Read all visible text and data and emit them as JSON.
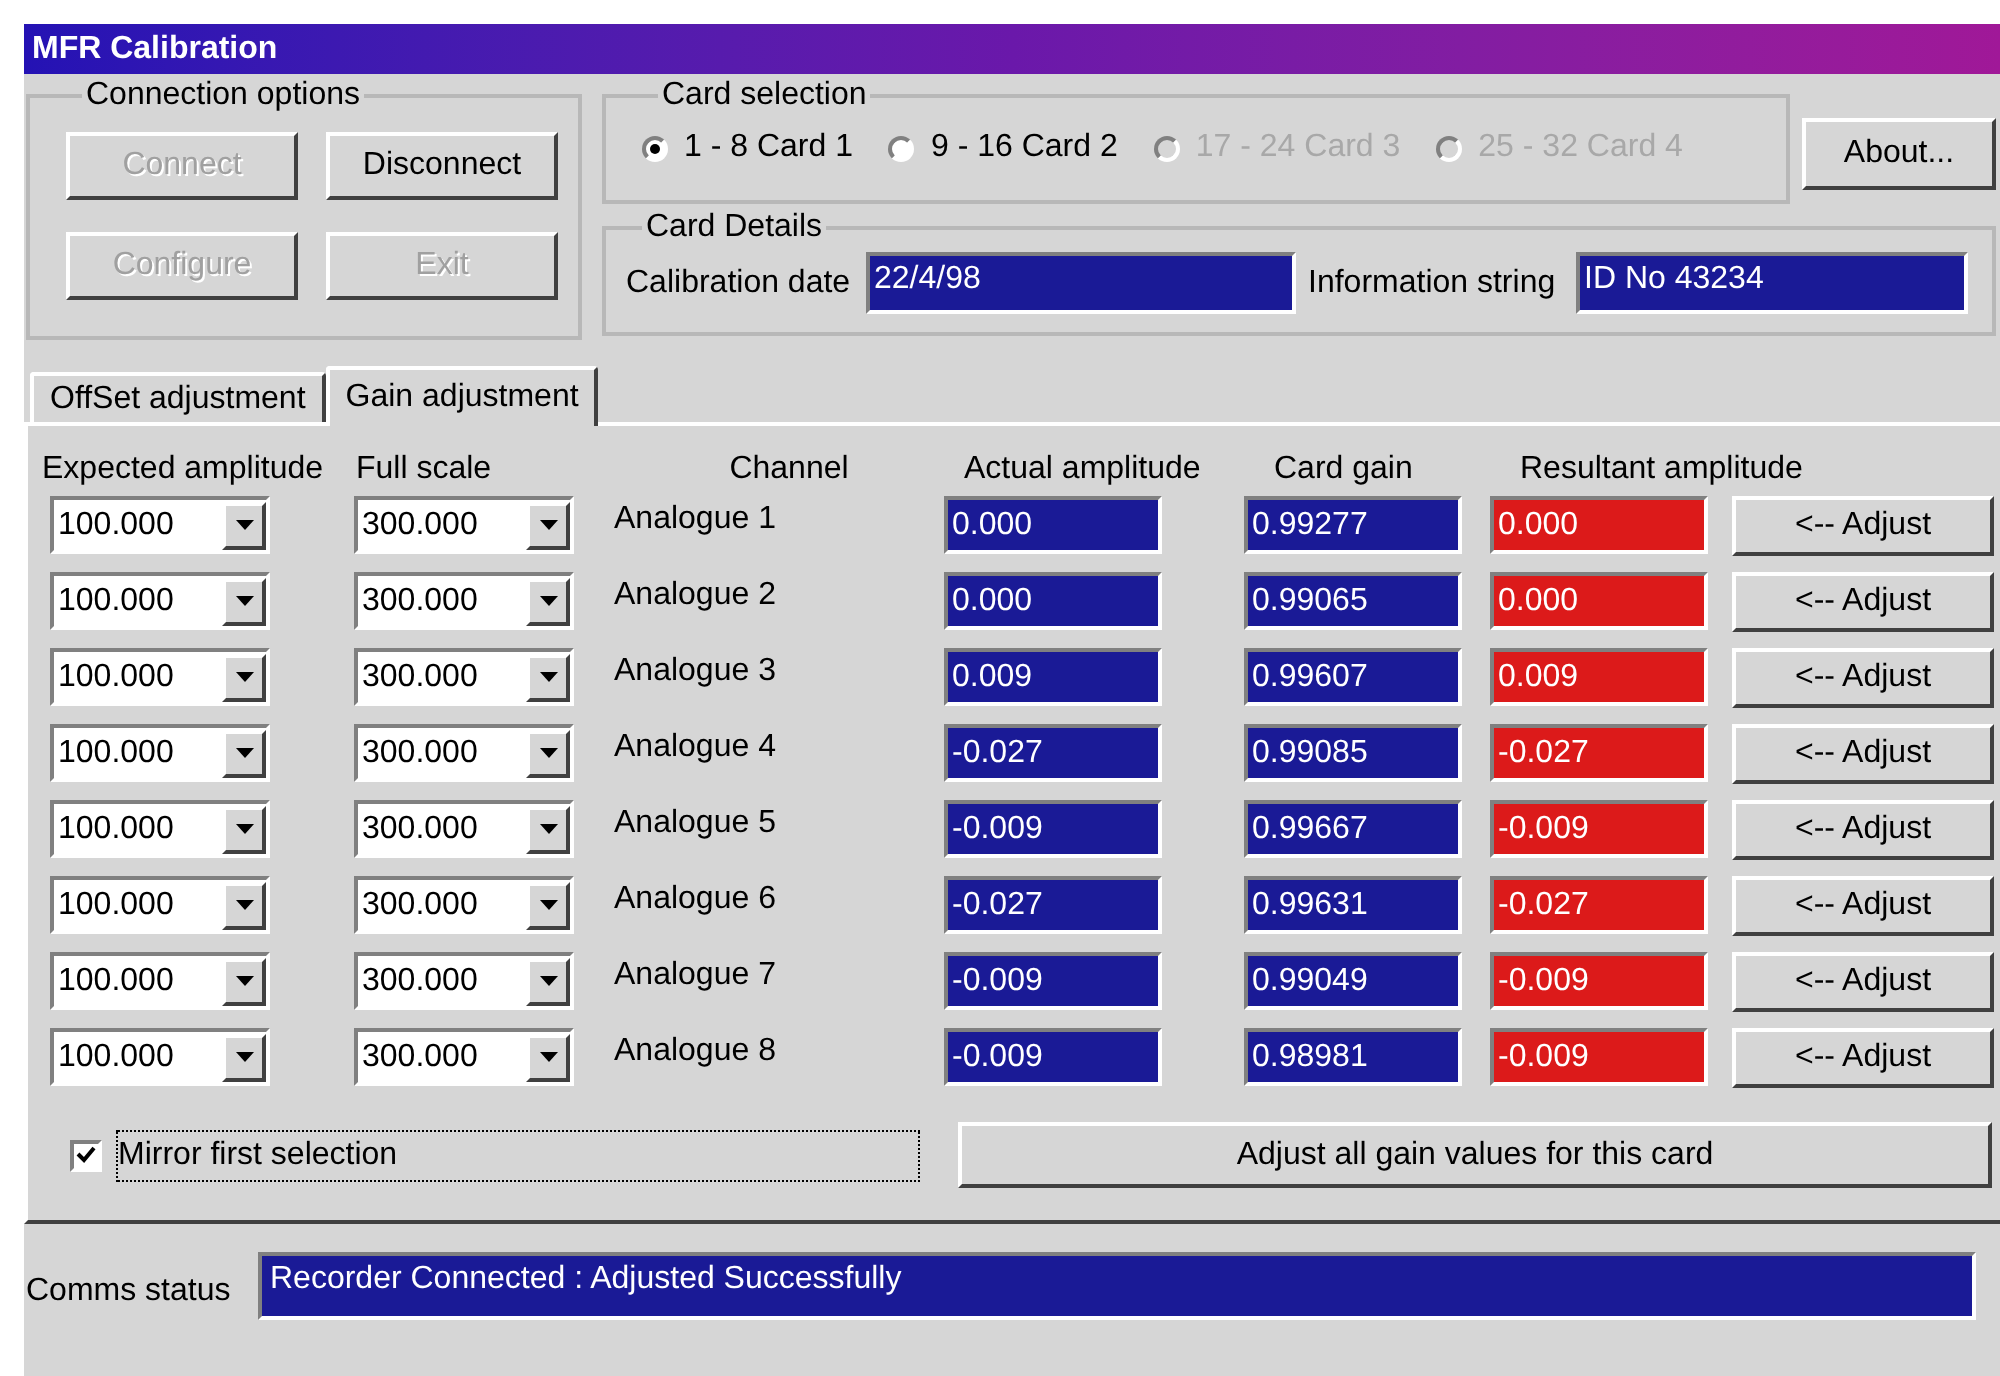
{
  "window": {
    "title": "MFR Calibration"
  },
  "connection_options": {
    "title": "Connection options",
    "buttons": [
      {
        "label": "Connect",
        "disabled": true
      },
      {
        "label": "Disconnect",
        "disabled": false
      },
      {
        "label": "Configure",
        "disabled": true
      },
      {
        "label": "Exit",
        "disabled": true
      }
    ]
  },
  "card_selection": {
    "title": "Card selection",
    "options": [
      {
        "label": "1 - 8 Card 1",
        "selected": true,
        "disabled": false
      },
      {
        "label": "9 - 16 Card 2",
        "selected": false,
        "disabled": false
      },
      {
        "label": "17 - 24 Card 3",
        "selected": false,
        "disabled": true
      },
      {
        "label": "25 - 32 Card 4",
        "selected": false,
        "disabled": true
      }
    ]
  },
  "about_button": {
    "label": "About..."
  },
  "card_details": {
    "title": "Card Details",
    "fields": [
      {
        "label": "Calibration date",
        "value": "22/4/98"
      },
      {
        "label": "Information string",
        "value": "ID No 43234"
      }
    ]
  },
  "tabs": [
    {
      "label": "OffSet adjustment",
      "selected": false
    },
    {
      "label": "Gain adjustment",
      "selected": true
    }
  ],
  "columns": [
    "Expected amplitude",
    "Full scale",
    "Channel",
    "Actual amplitude",
    "Card gain",
    "Resultant amplitude"
  ],
  "rows": [
    {
      "expected": "100.000",
      "full_scale": "300.000",
      "channel": "Analogue 1",
      "actual": "0.000",
      "gain": "0.99277",
      "resultant": "0.000",
      "button": "<-- Adjust"
    },
    {
      "expected": "100.000",
      "full_scale": "300.000",
      "channel": "Analogue 2",
      "actual": "0.000",
      "gain": "0.99065",
      "resultant": "0.000",
      "button": "<-- Adjust"
    },
    {
      "expected": "100.000",
      "full_scale": "300.000",
      "channel": "Analogue 3",
      "actual": "0.009",
      "gain": "0.99607",
      "resultant": "0.009",
      "button": "<-- Adjust"
    },
    {
      "expected": "100.000",
      "full_scale": "300.000",
      "channel": "Analogue 4",
      "actual": "-0.027",
      "gain": "0.99085",
      "resultant": "-0.027",
      "button": "<-- Adjust"
    },
    {
      "expected": "100.000",
      "full_scale": "300.000",
      "channel": "Analogue 5",
      "actual": "-0.009",
      "gain": "0.99667",
      "resultant": "-0.009",
      "button": "<-- Adjust"
    },
    {
      "expected": "100.000",
      "full_scale": "300.000",
      "channel": "Analogue 6",
      "actual": "-0.027",
      "gain": "0.99631",
      "resultant": "-0.027",
      "button": "<-- Adjust"
    },
    {
      "expected": "100.000",
      "full_scale": "300.000",
      "channel": "Analogue 7",
      "actual": "-0.009",
      "gain": "0.99049",
      "resultant": "-0.009",
      "button": "<-- Adjust"
    },
    {
      "expected": "100.000",
      "full_scale": "300.000",
      "channel": "Analogue 8",
      "actual": "-0.009",
      "gain": "0.98981",
      "resultant": "-0.009",
      "button": "<-- Adjust"
    }
  ],
  "mirror": {
    "label": "Mirror first selection",
    "checked": true,
    "focused": true
  },
  "adjust_all_button": {
    "label": "Adjust all gain values for this card"
  },
  "comms_status": {
    "label": "Comms status",
    "value": "Recorder Connected : Adjusted Successfully"
  }
}
